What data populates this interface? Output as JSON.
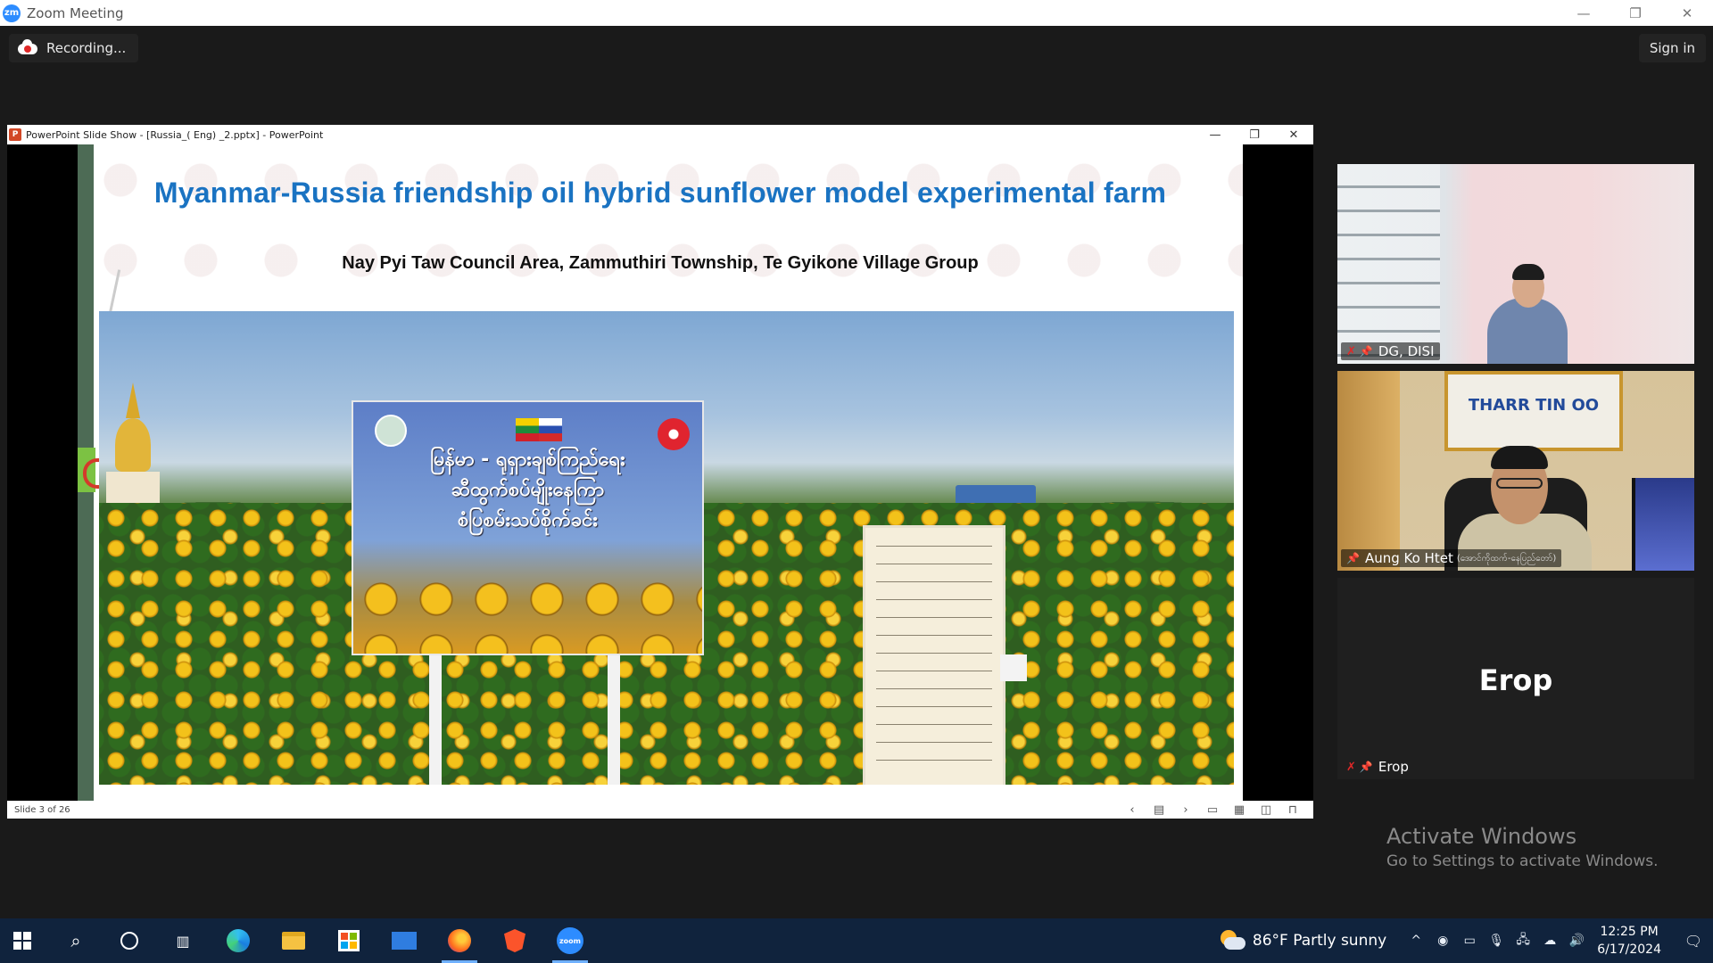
{
  "zoom": {
    "window_title": "Zoom Meeting",
    "recording_label": "Recording...",
    "sign_in_label": "Sign in",
    "logo_text": "zm"
  },
  "ppt": {
    "window_title": "PowerPoint Slide Show - [Russia_( Eng) _2.pptx] - PowerPoint",
    "slide_counter": "Slide 3 of 26",
    "slide": {
      "title": "Myanmar-Russia friendship oil hybrid sunflower model experimental farm",
      "subtitle": "Nay Pyi Taw Council Area, Zammuthiri Township, Te Gyikone Village Group",
      "sign_text_line1": "မြန်မာ - ရုရှားချစ်ကြည်ရေး",
      "sign_text_line2": "ဆီထွက်စပ်မျိုးနေကြာ",
      "sign_text_line3": "စံပြစမ်းသပ်စိုက်ခင်း"
    }
  },
  "participants": [
    {
      "name": "DG, DISI",
      "muted": true,
      "pinned": true
    },
    {
      "name": "Aung Ko Htet",
      "name_sub": "(အောင်ကိုထက်-နေပြည်တော်)",
      "muted": false,
      "pinned": true,
      "sign_text": "THARR TIN OO"
    },
    {
      "name": "Erop",
      "avatar_text": "Erop",
      "muted": true,
      "pinned": true
    }
  ],
  "watermark": {
    "title": "Activate Windows",
    "subtitle": "Go to Settings to activate Windows."
  },
  "taskbar": {
    "weather": "86°F  Partly sunny",
    "time": "12:25 PM",
    "date": "6/17/2024",
    "zoom_icon_text": "zoom"
  },
  "colors": {
    "slide_title": "#1a73c2",
    "taskbar_bg": "#10233d",
    "zoom_blue": "#2d8cff",
    "muted_red": "#e02828"
  },
  "icons": {
    "start": "windows-start-icon",
    "search": "search-icon",
    "cortana": "cortana-icon",
    "task_view": "task-view-icon",
    "edge": "edge-icon",
    "explorer": "folder-icon",
    "store": "store-icon",
    "mail": "mail-icon",
    "firefox": "firefox-icon",
    "brave": "brave-icon",
    "zoom": "zoom-icon"
  }
}
